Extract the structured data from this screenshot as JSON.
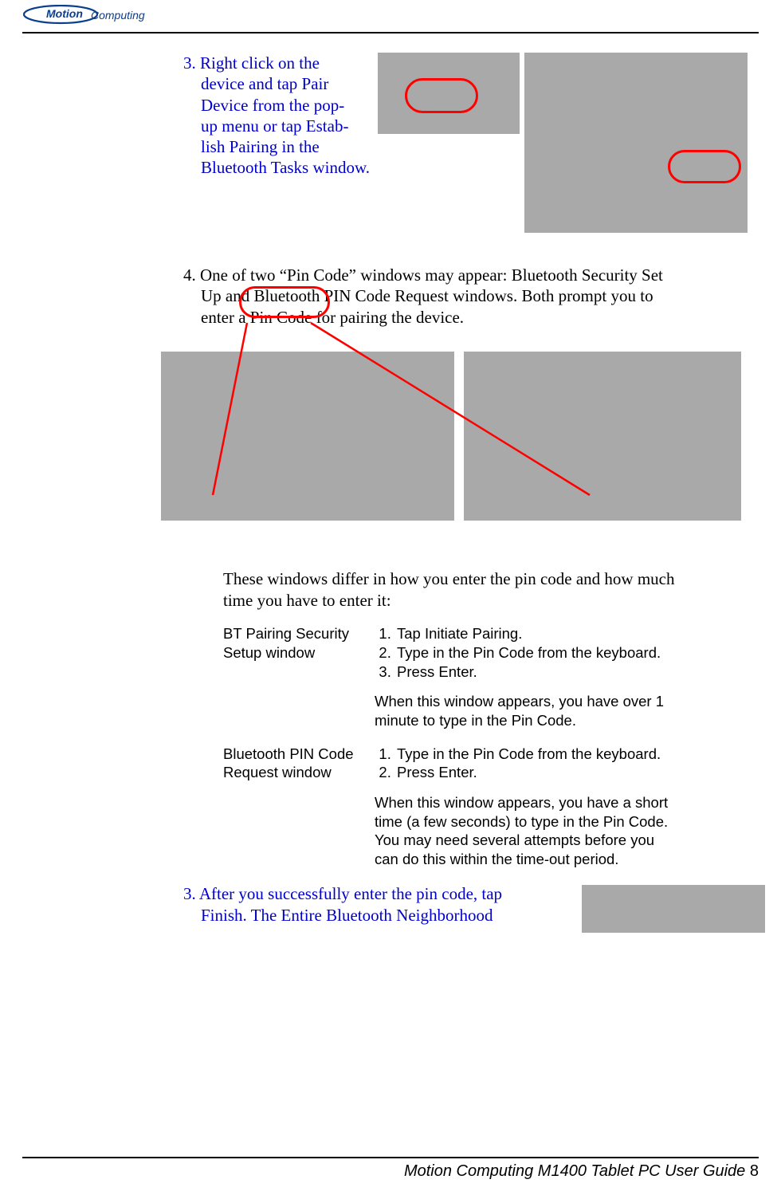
{
  "logo": {
    "brand_top": "Motion",
    "brand_bottom": "Computing"
  },
  "step3": {
    "number": "3.",
    "line1": "Right click on the",
    "line2": "device and tap Pair",
    "line3": "Device from the pop-",
    "line4": "up menu or tap Estab-",
    "line5": "lish Pairing in the",
    "line6": "Bluetooth Tasks window."
  },
  "step4": {
    "line1": "4. One of two “Pin Code” windows may appear: Bluetooth Security Set",
    "line2": "Up and Bluetooth PIN Code Request windows. Both prompt you to",
    "line3": "enter a Pin Code for pairing the device."
  },
  "intro": "These windows differ in how you enter the pin code and how much time you have to enter it:",
  "table": {
    "row1": {
      "label": "BT Pairing Security Setup window",
      "items": [
        " Tap Initiate Pairing.",
        "Type in the Pin Code from the keyboard.",
        "Press Enter."
      ],
      "note": "When this window appears, you have over 1 minute to type in the Pin Code."
    },
    "row2": {
      "label": "Bluetooth PIN Code Request window",
      "items": [
        "Type in the Pin Code from the keyboard.",
        "Press Enter."
      ],
      "note": "When this window appears, you have a short time (a few seconds) to type in the Pin Code. You may need several attempts before you can do this within the time-out period."
    }
  },
  "step_final": {
    "line1": "3. After you successfully enter the pin code, tap",
    "line2": "Finish. The Entire Bluetooth Neighborhood"
  },
  "footer": {
    "text": "Motion Computing M1400 Tablet PC User Guide",
    "page": "8"
  }
}
